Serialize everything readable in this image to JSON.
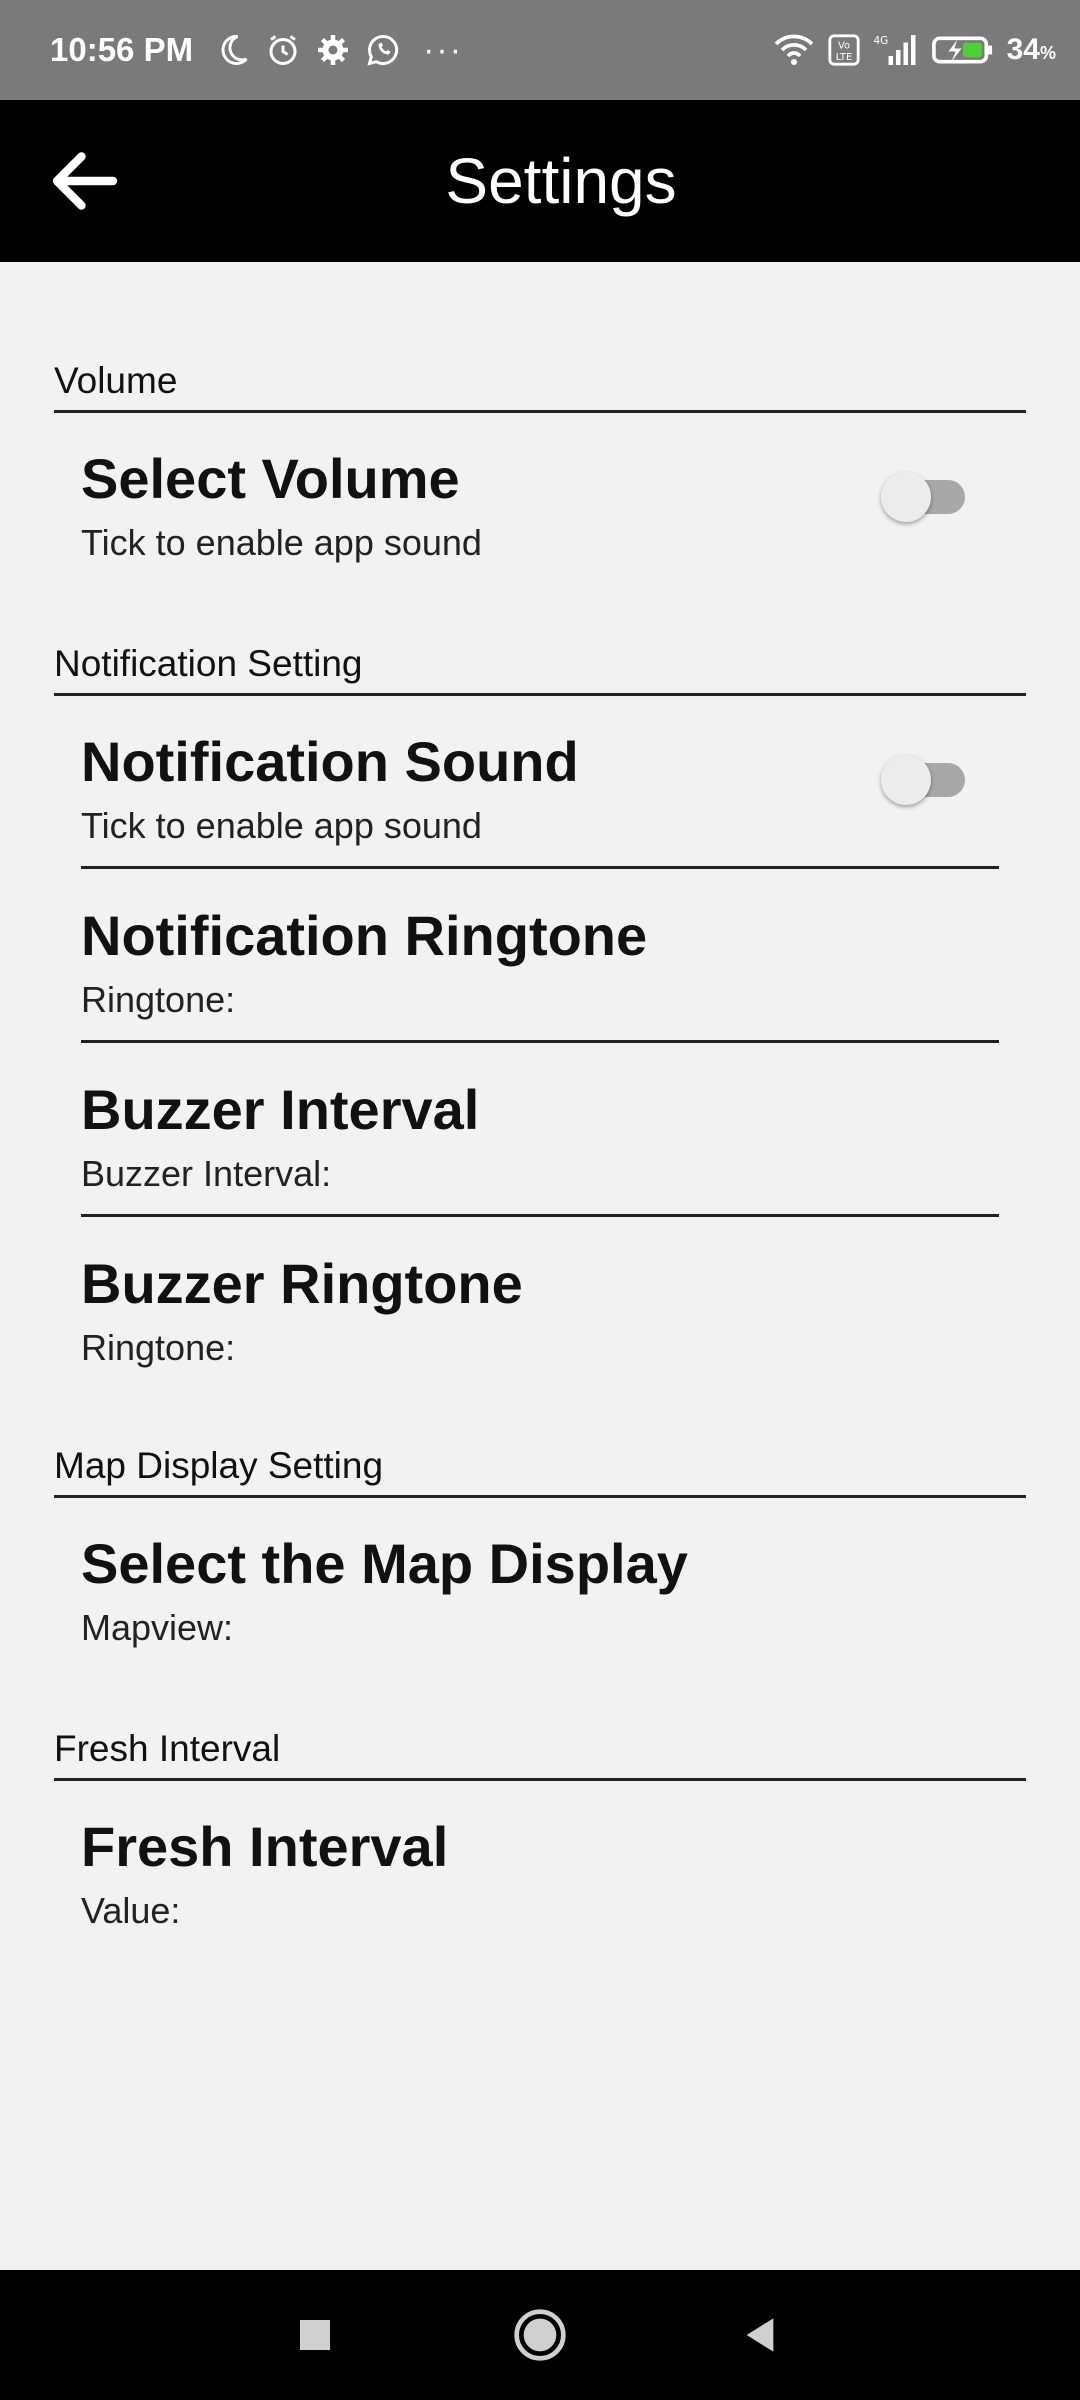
{
  "status_bar": {
    "time": "10:56 PM",
    "more": "···",
    "battery_value": "34",
    "battery_unit": "%",
    "icons": [
      "moon-icon",
      "alarm-icon",
      "gear-icon",
      "whatsapp-icon",
      "wifi-icon",
      "volte-icon",
      "signal-icon",
      "battery-charging-icon"
    ]
  },
  "app_bar": {
    "title": "Settings",
    "back_icon": "arrow-left-icon"
  },
  "sections": [
    {
      "header": "Volume",
      "items": [
        {
          "title": "Select Volume",
          "summary": "Tick to enable app sound",
          "switch_on": false
        }
      ]
    },
    {
      "header": "Notification Setting",
      "items": [
        {
          "title": "Notification Sound",
          "summary": "Tick to enable app sound",
          "switch_on": false
        },
        {
          "title": "Notification Ringtone",
          "summary": "Ringtone:"
        },
        {
          "title": "Buzzer Interval",
          "summary": "Buzzer Interval:"
        },
        {
          "title": "Buzzer Ringtone",
          "summary": "Ringtone:"
        }
      ]
    },
    {
      "header": "Map Display Setting",
      "items": [
        {
          "title": "Select the Map Display",
          "summary": "Mapview:"
        }
      ]
    },
    {
      "header": "Fresh Interval",
      "items": [
        {
          "title": "Fresh Interval",
          "summary": "Value:"
        }
      ]
    }
  ],
  "nav_bar": {
    "icons": [
      "recents-square-icon",
      "home-circle-icon",
      "back-triangle-icon"
    ]
  },
  "colors": {
    "status_bar_bg": "#7a7a7a",
    "app_bar_bg": "#000000",
    "content_bg": "#f2f2f2",
    "switch_track": "#a8a8a8",
    "switch_thumb": "#ececec"
  }
}
